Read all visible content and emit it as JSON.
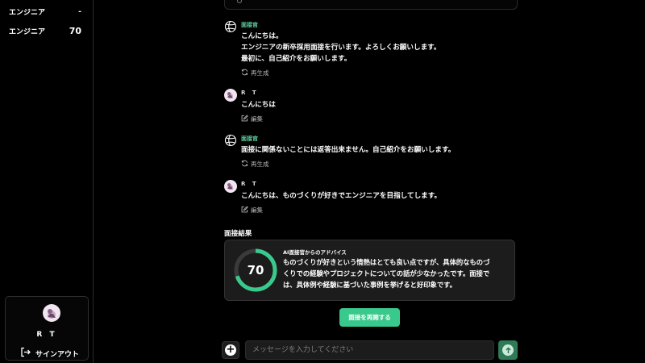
{
  "sidebar": {
    "items": [
      {
        "label": "エンジニア",
        "value": "-"
      },
      {
        "label": "エンジニア",
        "value": "70"
      }
    ],
    "user": {
      "name": "R T",
      "signout_label": "サインアウト"
    }
  },
  "chat": {
    "messages": [
      {
        "sender": "面接官",
        "role": "bot",
        "text": [
          "こんにちは。",
          "エンジニアの新卒採用面接を行います。よろしくお願いします。",
          "最初に、自己紹介をお願いします。"
        ],
        "action": "再生成"
      },
      {
        "sender": "R T",
        "role": "user",
        "text": [
          "こんにちは"
        ],
        "action": "編集"
      },
      {
        "sender": "面接官",
        "role": "bot",
        "text": [
          "面接に関係ないことには返答出来ません。自己紹介をお願いします。"
        ],
        "action": "再生成"
      },
      {
        "sender": "R T",
        "role": "user",
        "text": [
          "こんにちは、ものづくりが好きでエンジニアを目指してします。"
        ],
        "action": "編集"
      }
    ]
  },
  "result": {
    "title": "面接結果",
    "score": 70,
    "score_label": "70",
    "advice_title": "AI面接官からのアドバイス",
    "advice_lines": [
      "ものづくりが好きという情熱はとても良い点ですが、具体的なものづ",
      "くりでの経験やプロジェクトについての話が少なかったです。面接で",
      "は、具体例や経験に基づいた事例を挙げると好印象です。"
    ]
  },
  "restart_label": "面接を再開する",
  "composer": {
    "placeholder": "メッセージを入力してください"
  },
  "colors": {
    "accent": "#3ac98c",
    "bot_name": "#5ed3a0",
    "gauge_track": "#3a3a3a"
  },
  "icons": {
    "bot": "openai-logo-icon",
    "regenerate": "refresh-icon",
    "edit": "edit-icon",
    "signout": "signout-icon",
    "plus": "plus-icon",
    "send": "arrow-up-icon"
  }
}
